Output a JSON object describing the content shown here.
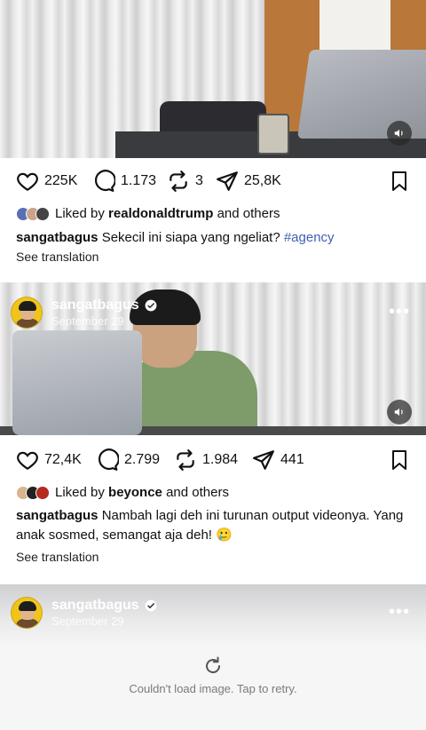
{
  "post1": {
    "likes": "225K",
    "comments": "1.173",
    "reposts": "3",
    "shares": "25,8K",
    "liked_by_prefix": "Liked by",
    "liked_by_user": "realdonaldtrump",
    "liked_by_suffix": "and others",
    "caption_user": "sangatbagus",
    "caption_text": "Sekecil ini siapa yang ngeliat?",
    "caption_tag": "#agency",
    "see_translation": "See translation"
  },
  "post2": {
    "username": "sangatbagus",
    "date": "September 29",
    "likes": "72,4K",
    "comments": "2.799",
    "reposts": "1.984",
    "shares": "441",
    "liked_by_prefix": "Liked by",
    "liked_by_user": "beyonce",
    "liked_by_suffix": "and others",
    "caption_user": "sangatbagus",
    "caption_text": "Nambah lagi deh ini turunan output videonya. Yang anak sosmed, semangat aja deh! 🥲",
    "see_translation": "See translation"
  },
  "post3": {
    "username": "sangatbagus",
    "date": "September 29",
    "error_text": "Couldn't load image. Tap to retry."
  },
  "colors": {
    "hashtag": "#3f5fb0",
    "avatar_bg": "#f0c419",
    "overlay": "#282828"
  },
  "icons": [
    "heart-icon",
    "comment-icon",
    "repost-icon",
    "share-icon",
    "bookmark-icon",
    "volume-icon",
    "verified-icon",
    "more-icon",
    "retry-icon"
  ]
}
